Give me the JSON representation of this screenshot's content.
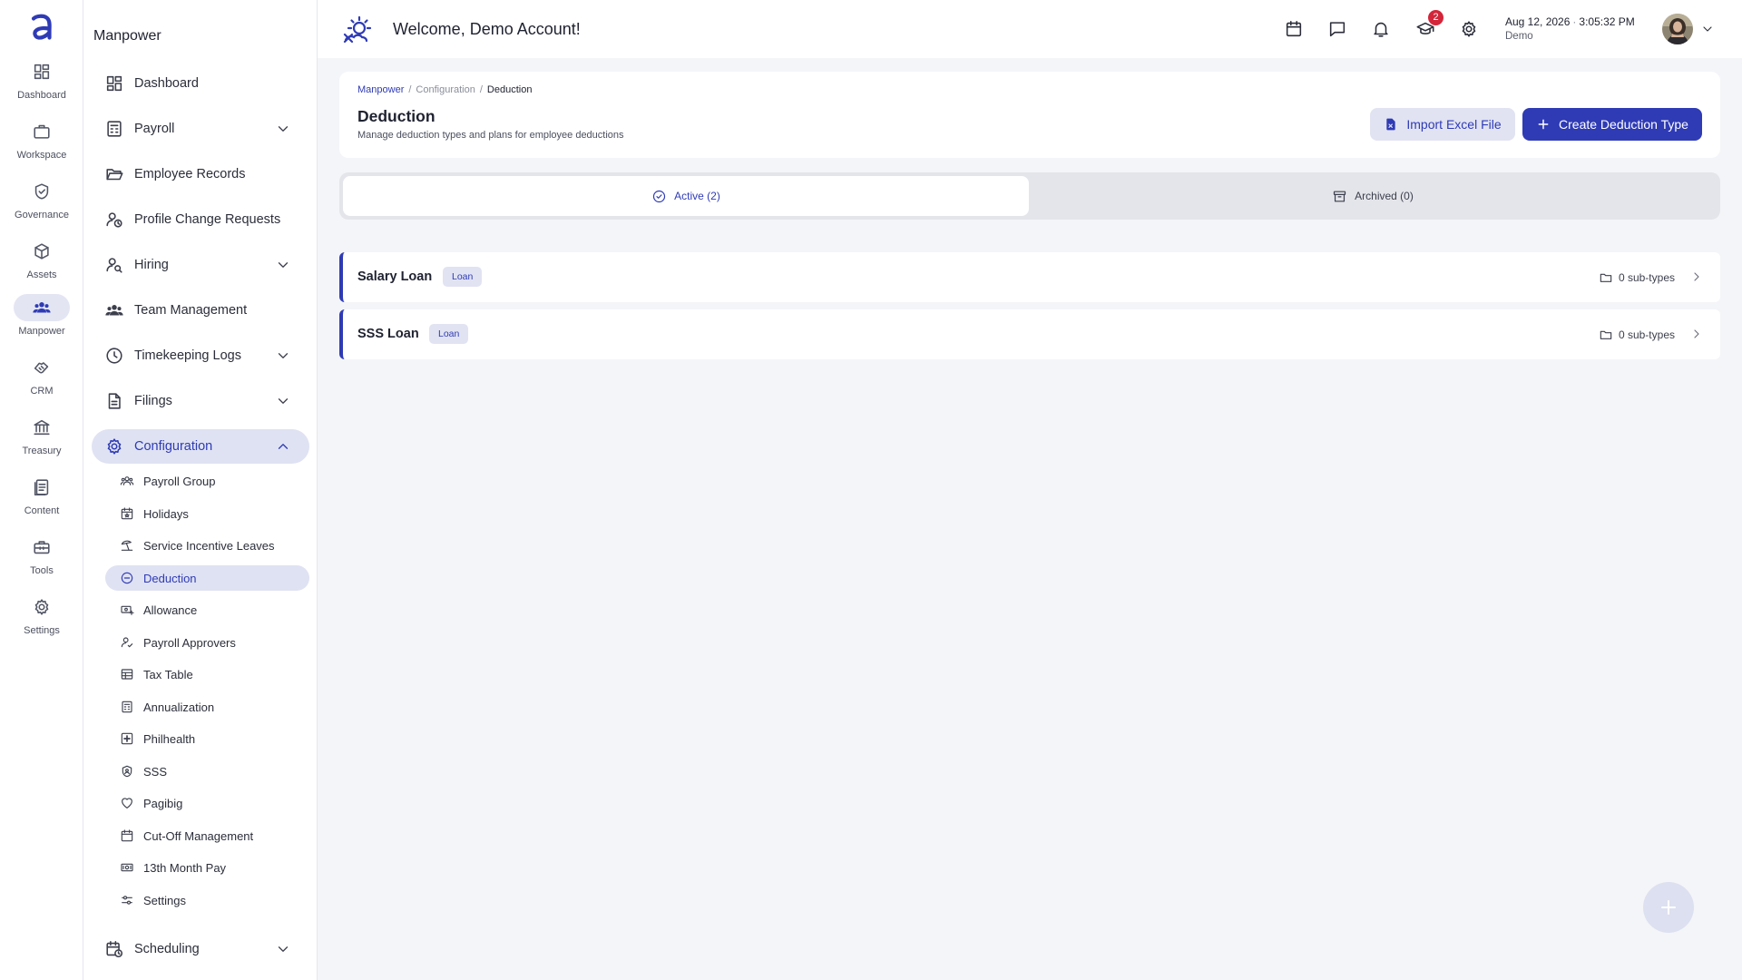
{
  "rail": {
    "items": [
      {
        "label": "Dashboard",
        "icon": "dashboard-icon"
      },
      {
        "label": "Workspace",
        "icon": "briefcase-icon"
      },
      {
        "label": "Governance",
        "icon": "shield-icon"
      },
      {
        "label": "Assets",
        "icon": "box-icon"
      },
      {
        "label": "Manpower",
        "icon": "people-icon"
      },
      {
        "label": "CRM",
        "icon": "handshake-icon"
      },
      {
        "label": "Treasury",
        "icon": "bank-icon"
      },
      {
        "label": "Content",
        "icon": "document-icon"
      },
      {
        "label": "Tools",
        "icon": "toolbox-icon"
      },
      {
        "label": "Settings",
        "icon": "gear-icon"
      }
    ]
  },
  "sidebar": {
    "title": "Manpower",
    "items": [
      {
        "label": "Dashboard"
      },
      {
        "label": "Payroll"
      },
      {
        "label": "Employee Records"
      },
      {
        "label": "Profile Change Requests"
      },
      {
        "label": "Hiring"
      },
      {
        "label": "Team Management"
      },
      {
        "label": "Timekeeping Logs"
      },
      {
        "label": "Filings"
      },
      {
        "label": "Configuration"
      },
      {
        "label": "Scheduling"
      }
    ],
    "config_items": [
      {
        "label": "Payroll Group"
      },
      {
        "label": "Holidays"
      },
      {
        "label": "Service Incentive Leaves"
      },
      {
        "label": "Deduction"
      },
      {
        "label": "Allowance"
      },
      {
        "label": "Payroll Approvers"
      },
      {
        "label": "Tax Table"
      },
      {
        "label": "Annualization"
      },
      {
        "label": "Philhealth"
      },
      {
        "label": "SSS"
      },
      {
        "label": "Pagibig"
      },
      {
        "label": "Cut-Off Management"
      },
      {
        "label": "13th Month Pay"
      },
      {
        "label": "Settings"
      }
    ]
  },
  "topbar": {
    "welcome": "Welcome, Demo Account!",
    "notification_count": "2",
    "date": "Aug 12, 2026",
    "time": "3:05:32 PM",
    "user": "Demo"
  },
  "header": {
    "breadcrumb": [
      "Manpower",
      "Configuration",
      "Deduction"
    ],
    "title": "Deduction",
    "description": "Manage deduction types and plans for employee deductions",
    "import_label": "Import Excel File",
    "create_label": "Create Deduction Type"
  },
  "tabs": {
    "active_label": "Active (2)",
    "archived_label": "Archived (0)"
  },
  "deductions": [
    {
      "name": "Salary Loan",
      "tag": "Loan",
      "subtypes": "0 sub-types"
    },
    {
      "name": "SSS Loan",
      "tag": "Loan",
      "subtypes": "0 sub-types"
    }
  ],
  "colors": {
    "accent": "#2f3bb5",
    "badge": "#d3263a"
  }
}
